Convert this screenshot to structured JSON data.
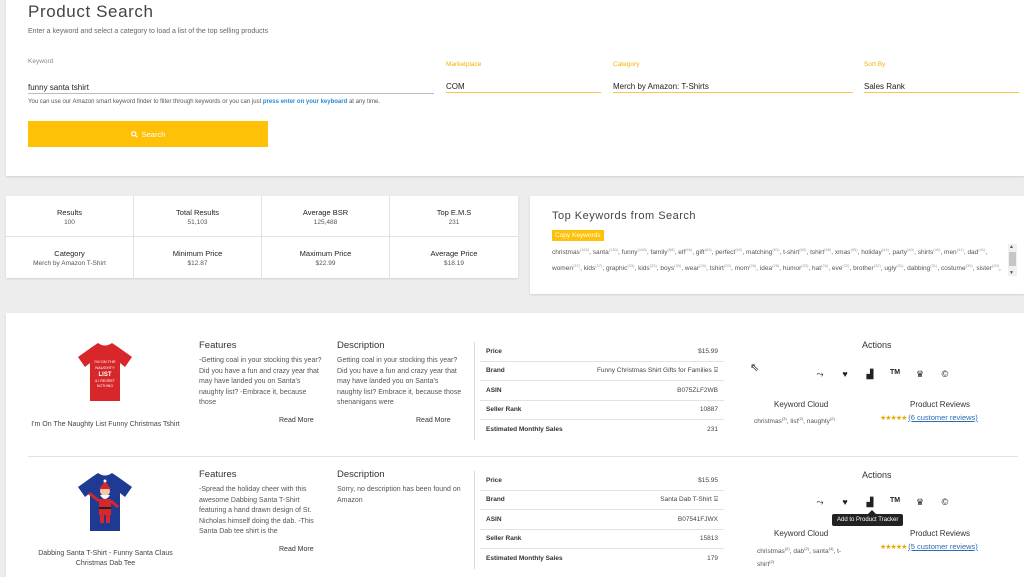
{
  "header": {
    "title": "Product Search",
    "subtitle": "Enter a keyword and select a category to load a list of the top selling products"
  },
  "form": {
    "keyword_label": "Keyword",
    "keyword_value": "funny santa tshirt",
    "marketplace_label": "Marketplace",
    "marketplace_value": "COM",
    "category_label": "Category",
    "category_value": "Merch by Amazon: T-Shirts",
    "sort_label": "Sort By",
    "sort_value": "Sales Rank",
    "hint_prefix": "You can use our Amazon smart keyword finder to filter through keywords or you can just",
    "hint_link": "press enter on your keyboard",
    "hint_suffix": "at any time.",
    "search_label": "Search",
    "accent_color": "#ffc107"
  },
  "stats": [
    {
      "label": "Results",
      "value": "100"
    },
    {
      "label": "Total Results",
      "value": "51,103"
    },
    {
      "label": "Average BSR",
      "value": "125,488"
    },
    {
      "label": "Top E.M.S",
      "value": "231"
    },
    {
      "label": "Category",
      "value": "Merch by Amazon T-Shirt"
    },
    {
      "label": "Minimum Price",
      "value": "$12.87"
    },
    {
      "label": "Maximum Price",
      "value": "$22.99"
    },
    {
      "label": "Average Price",
      "value": "$18.19"
    }
  ],
  "top_keywords": {
    "title": "Top Keywords from Search",
    "copy_label": "Copy Keywords",
    "keywords": [
      {
        "word": "christmas",
        "count": "(162)"
      },
      {
        "word": "santa",
        "count": "(130)"
      },
      {
        "word": "funny",
        "count": "(108)"
      },
      {
        "word": "family",
        "count": "(88)"
      },
      {
        "word": "elf",
        "count": "(69)"
      },
      {
        "word": "gift",
        "count": "(64)"
      },
      {
        "word": "perfect",
        "count": "(60)"
      },
      {
        "word": "matching",
        "count": "(61)"
      },
      {
        "word": "t-shirt",
        "count": "(60)"
      },
      {
        "word": "tshirt",
        "count": "(56)"
      },
      {
        "word": "xmas",
        "count": "(55)"
      },
      {
        "word": "holiday",
        "count": "(44)"
      },
      {
        "word": "party",
        "count": "(40)"
      },
      {
        "word": "shirts",
        "count": "(40)"
      },
      {
        "word": "men",
        "count": "(41)"
      },
      {
        "word": "dad",
        "count": "(41)"
      },
      {
        "word": "women",
        "count": "(37)"
      },
      {
        "word": "kids",
        "count": "(37)"
      },
      {
        "word": "graphic",
        "count": "(33)"
      },
      {
        "word": "kids",
        "count": "(33)"
      },
      {
        "word": "boys",
        "count": "(30)"
      },
      {
        "word": "wear",
        "count": "(29)"
      },
      {
        "word": "tshirt",
        "count": "(29)"
      },
      {
        "word": "mom",
        "count": "(28)"
      },
      {
        "word": "idea",
        "count": "(28)"
      },
      {
        "word": "humor",
        "count": "(33)"
      },
      {
        "word": "hat",
        "count": "(33)"
      },
      {
        "word": "eve",
        "count": "(32)"
      },
      {
        "word": "brother",
        "count": "(32)"
      },
      {
        "word": "ugly",
        "count": "(31)"
      },
      {
        "word": "dabbing",
        "count": "(31)"
      },
      {
        "word": "costume",
        "count": "(30)"
      },
      {
        "word": "sister",
        "count": "(29)"
      },
      {
        "word": "grandma",
        "count": "(29)"
      },
      {
        "word": "shark",
        "count": "(29)"
      },
      {
        "word": "doo",
        "count": "(28)"
      },
      {
        "word": "as",
        "count": "(27)"
      },
      {
        "word": "tree",
        "count": "(29)"
      },
      {
        "word": "pj",
        "count": "(29)"
      },
      {
        "word": "clothing",
        "count": "(28)"
      }
    ]
  },
  "columns": {
    "features": "Features",
    "description": "Description",
    "actions": "Actions",
    "keyword_cloud": "Keyword Cloud",
    "product_reviews": "Product Reviews",
    "read_more": "Read More"
  },
  "products": [
    {
      "name": "I'm On The Naughty List Funny Christmas Tshirt",
      "shirt_color": "#d8272a",
      "shirt_text": "I'M ON THE NAUGHTY LIST & I REGRET NOTHING",
      "features": "-Getting coal in your stocking this year? Did you have a fun and crazy year that may have landed you on Santa's naughty list? -Embrace it, because those",
      "description": "Getting coal in your stocking this year? Did you have a fun and crazy year that may have landed you on Santa's naughty list? Embrace it, because those shenanigans were",
      "details": [
        {
          "key": "Price",
          "value": "$15.99"
        },
        {
          "key": "Brand",
          "value": "Funny Christmas Shirt Gifts for Families"
        },
        {
          "key": "ASIN",
          "value": "B075ZLF2WB"
        },
        {
          "key": "Seller Rank",
          "value": "10887"
        },
        {
          "key": "Estimated Monthly Sales",
          "value": "231"
        }
      ],
      "keyword_cloud": [
        {
          "word": "christmas",
          "count": "(3)"
        },
        {
          "word": "list",
          "count": "(2)"
        },
        {
          "word": "naughty",
          "count": "(2)"
        }
      ],
      "rating": 4.5,
      "reviews": "(6 customer reviews)"
    },
    {
      "name": "Dabbing Santa T-Shirt - Funny Santa Claus Christmas Dab Tee",
      "shirt_color": "#1f3a93",
      "shirt_text": "",
      "features": "-Spread the holiday cheer with this awesome Dabbing Santa T-Shirt featuring a hand drawn design of St. Nicholas himself doing the dab. -This Santa Dab tee shirt is the",
      "description": "Sorry, no description has been found on Amazon",
      "details": [
        {
          "key": "Price",
          "value": "$15.95"
        },
        {
          "key": "Brand",
          "value": "Santa Dab T-Shirt"
        },
        {
          "key": "ASIN",
          "value": "B07541FJWX"
        },
        {
          "key": "Seller Rank",
          "value": "15813"
        },
        {
          "key": "Estimated Monthly Sales",
          "value": "179"
        }
      ],
      "keyword_cloud": [
        {
          "word": "christmas",
          "count": "(2)"
        },
        {
          "word": "dab",
          "count": "(2)"
        },
        {
          "word": "santa",
          "count": "(4)"
        },
        {
          "word": "t-shirt",
          "count": "(2)"
        }
      ],
      "rating": 4.5,
      "reviews": "(5 customer reviews)"
    }
  ],
  "tooltip": "Add to Product Tracker",
  "action_icons": [
    "trend-icon",
    "heart-icon",
    "bar-chart-icon",
    "trademark-icon",
    "crown-icon",
    "copyright-icon"
  ]
}
